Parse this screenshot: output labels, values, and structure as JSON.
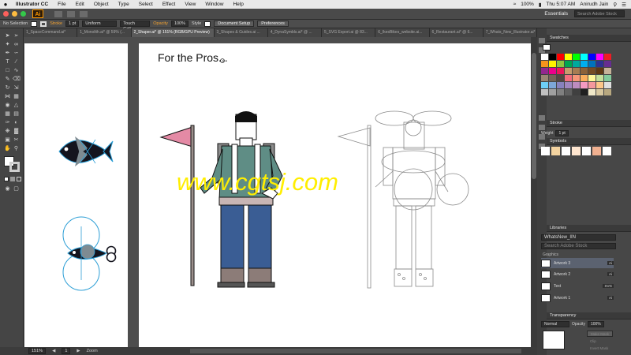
{
  "menubar": {
    "apple": "",
    "app": "Illustrator CC",
    "items": [
      "File",
      "Edit",
      "Object",
      "Type",
      "Select",
      "Effect",
      "View",
      "Window",
      "Help"
    ],
    "battery": "100%",
    "clock": "Thu 5:07 AM",
    "user": "Anirudh Jain"
  },
  "appbar": {
    "logo": "Ai",
    "workspace": "Essentials",
    "search_placeholder": "Search Adobe Stock"
  },
  "control": {
    "selection": "No Selection",
    "stroke_label": "Stroke",
    "stroke_weight": "1 pt",
    "profile": "Uniform",
    "brush": "Touch Call...",
    "opacity_label": "Opacity",
    "opacity": "100%",
    "style_label": "Style",
    "doc_setup": "Document Setup",
    "preferences": "Preferences"
  },
  "tabs": [
    "1_SpaceCommand.ai*",
    "1_Monolith.ai* @ 59% (...",
    "2_Shaper.ai* @ 151% (RGB/GPU Preview)",
    "3_Shapes & Guides.ai ...",
    "4_DynaSymbls.ai* @ ...",
    "5_SVG Export.ai @ 83...",
    "6_IkesBikes_website.ai...",
    "6_Restaurant.ai* @ 6...",
    "7_Whats_New_Illustrator.ai*"
  ],
  "canvas": {
    "heading": "For the Pros...",
    "watermark": "www.cgtsj.com"
  },
  "status": {
    "zoom": "151%",
    "page": "1",
    "tool": "Zoom"
  },
  "panels": {
    "swatches_title": "Swatches",
    "stroke_title": "Stroke",
    "weight_label": "Weight",
    "weight": "1 pt",
    "symbols_title": "Symbols",
    "libraries_title": "Libraries",
    "library_name": "WhatsNew_IIN",
    "library_search": "Search Adobe Stock",
    "graphics_label": "Graphics",
    "assets": [
      {
        "name": "Artwork 3",
        "tag": "Ai"
      },
      {
        "name": "Artwork 2",
        "tag": "Ai"
      },
      {
        "name": "Text",
        "tag": "SVG"
      },
      {
        "name": "Artwork 1",
        "tag": "Ai"
      }
    ],
    "transparency_title": "Transparency",
    "blend_mode": "Normal",
    "opacity_label": "Opacity",
    "opacity": "100%",
    "make_mask": "Make Mask",
    "clip": "Clip",
    "invert_mask": "Invert Mask"
  },
  "colors": {
    "flag": "#e48aa5",
    "jacket": "#5f8d85",
    "pants": "#3a5d94",
    "boots": "#8c7c78",
    "pole": "#9b8f8b",
    "selection": "#2e9fd6",
    "fish": "#14141e",
    "watermark": "#ffee00"
  },
  "swatch_colors": [
    "#ffffff",
    "#000000",
    "#ff0000",
    "#ffff00",
    "#00ff00",
    "#00ffff",
    "#0000ff",
    "#ff00ff",
    "#ed1c24",
    "#f7941d",
    "#fff200",
    "#8dc63f",
    "#00a651",
    "#00a99d",
    "#00aeef",
    "#0072bc",
    "#2e3192",
    "#662d91",
    "#92278f",
    "#ec008c",
    "#ed145b",
    "#c69c6d",
    "#a67c52",
    "#8c6239",
    "#754c24",
    "#603913",
    "#c7b299",
    "#998675",
    "#736357",
    "#534741",
    "#f26d7d",
    "#f69679",
    "#fbaf5d",
    "#fff799",
    "#c4df9b",
    "#82ca9c",
    "#6dcff6",
    "#7da7d9",
    "#8781bd",
    "#a186be",
    "#bd8cbf",
    "#f49ac1",
    "#f5989d",
    "#fdc689",
    "#e0e0e0",
    "#c0c0c0",
    "#a0a0a0",
    "#808080",
    "#606060",
    "#404040",
    "#202020",
    "#f0e8c8",
    "#d8c8a0",
    "#b8a880"
  ]
}
